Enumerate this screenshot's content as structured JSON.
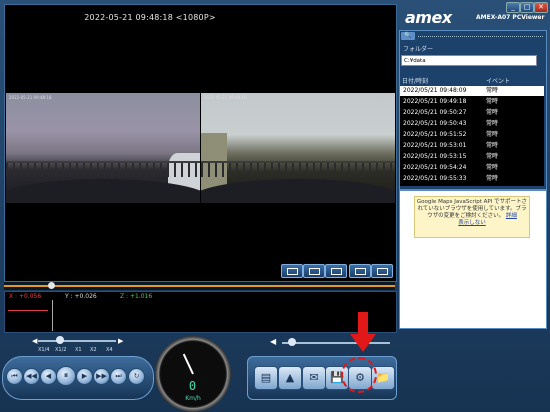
{
  "window": {
    "logo": "amex",
    "title": "AMEX-A07 PCViewer",
    "minimize": "_",
    "maximize": "□",
    "close": "✕"
  },
  "video": {
    "timestamp": "2022-05-21 09:48:18 <1080P>",
    "front_osd": "2022-05-21 09:48:18",
    "rear_osd": "2022-05-21 09:48:18"
  },
  "gsensor": {
    "x_label": "X : +0.056",
    "y_label": "Y : +0.026",
    "z_label": "Z : +1.016"
  },
  "playback": {
    "speed_labels": [
      "X1/4",
      "X1/2",
      "X1",
      "X2",
      "X4"
    ],
    "seek_fraction": 0.12
  },
  "speedometer": {
    "digits": "0",
    "unit": "Km/h"
  },
  "panel": {
    "search_icon": "🔍",
    "folder_label": "フォルダー",
    "folder_path": "C:¥data",
    "col_date": "日付/時刻",
    "col_event": "イベント",
    "events": [
      {
        "date": "2022/05/21 09:48:09",
        "type": "常時",
        "selected": true
      },
      {
        "date": "2022/05/21 09:49:18",
        "type": "常時"
      },
      {
        "date": "2022/05/21 09:50:27",
        "type": "常時"
      },
      {
        "date": "2022/05/21 09:50:43",
        "type": "常時"
      },
      {
        "date": "2022/05/21 09:51:52",
        "type": "常時"
      },
      {
        "date": "2022/05/21 09:53:01",
        "type": "常時"
      },
      {
        "date": "2022/05/21 09:53:15",
        "type": "常時"
      },
      {
        "date": "2022/05/21 09:54:24",
        "type": "常時"
      },
      {
        "date": "2022/05/21 09:55:33",
        "type": "常時"
      }
    ]
  },
  "map": {
    "notice": "Google Maps JavaScript API でサポートされていないブラウザを使用しています。ブラウザの変更をご検討ください。",
    "link": "詳細",
    "dismiss": "表示しない"
  },
  "icons": {
    "rewind": "⏮",
    "back": "◀◀",
    "step_back": "◀",
    "play": "⏸",
    "step_fwd": "▶",
    "fwd": "▶▶",
    "end": "⏭",
    "loop": "↻",
    "volume": "◀",
    "tool1": "▤",
    "tool2": "▲",
    "tool3": "✉",
    "tool4": "💾",
    "tool5": "⚙",
    "tool6": "📁"
  }
}
